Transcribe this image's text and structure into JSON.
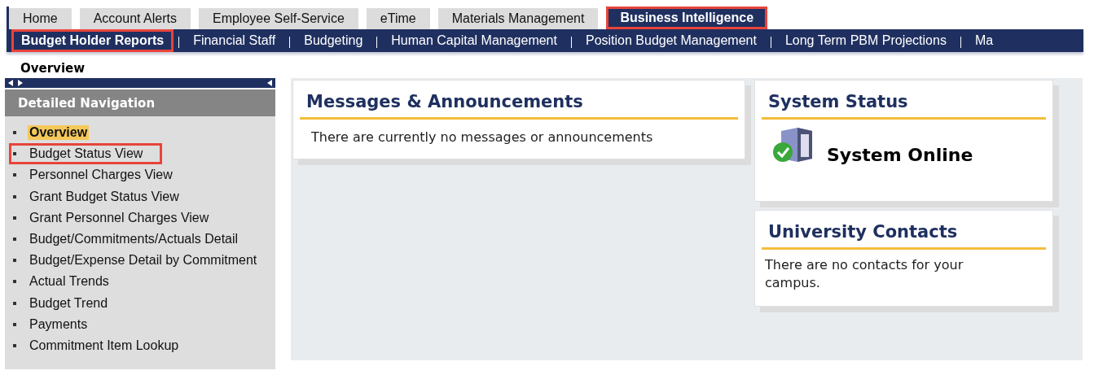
{
  "top_tabs": [
    {
      "label": "Home",
      "selected": false,
      "highlighted": false
    },
    {
      "label": "Account Alerts",
      "selected": false,
      "highlighted": false
    },
    {
      "label": "Employee Self-Service",
      "selected": false,
      "highlighted": false
    },
    {
      "label": "eTime",
      "selected": false,
      "highlighted": false
    },
    {
      "label": "Materials Management",
      "selected": false,
      "highlighted": false
    },
    {
      "label": "Business Intelligence",
      "selected": true,
      "highlighted": true
    }
  ],
  "sub_tabs": [
    {
      "label": "Budget Holder Reports",
      "selected": true,
      "highlighted": true
    },
    {
      "label": "Financial Staff",
      "selected": false,
      "highlighted": false
    },
    {
      "label": "Budgeting",
      "selected": false,
      "highlighted": false
    },
    {
      "label": "Human Capital Management",
      "selected": false,
      "highlighted": false
    },
    {
      "label": "Position Budget Management",
      "selected": false,
      "highlighted": false
    },
    {
      "label": "Long Term PBM Projections",
      "selected": false,
      "highlighted": false
    },
    {
      "label": "Ma",
      "selected": false,
      "highlighted": false
    }
  ],
  "page_title": "Overview",
  "sidebar": {
    "title": "Detailed Navigation",
    "items": [
      {
        "label": "Overview",
        "selected": true,
        "highlighted": false
      },
      {
        "label": "Budget Status View",
        "selected": false,
        "highlighted": true
      },
      {
        "label": "Personnel Charges View",
        "selected": false,
        "highlighted": false
      },
      {
        "label": "Grant Budget Status View",
        "selected": false,
        "highlighted": false
      },
      {
        "label": "Grant Personnel Charges View",
        "selected": false,
        "highlighted": false
      },
      {
        "label": "Budget/Commitments/Actuals Detail",
        "selected": false,
        "highlighted": false
      },
      {
        "label": "Budget/Expense Detail by Commitment",
        "selected": false,
        "highlighted": false
      },
      {
        "label": "Actual Trends",
        "selected": false,
        "highlighted": false
      },
      {
        "label": "Budget Trend",
        "selected": false,
        "highlighted": false
      },
      {
        "label": "Payments",
        "selected": false,
        "highlighted": false
      },
      {
        "label": "Commitment Item Lookup",
        "selected": false,
        "highlighted": false
      }
    ]
  },
  "messages": {
    "title": "Messages & Announcements",
    "text": "There are currently no messages or announcements"
  },
  "system_status": {
    "title": "System Status",
    "status": "System Online"
  },
  "contacts": {
    "title": "University Contacts",
    "text": "There are no contacts for your campus."
  }
}
